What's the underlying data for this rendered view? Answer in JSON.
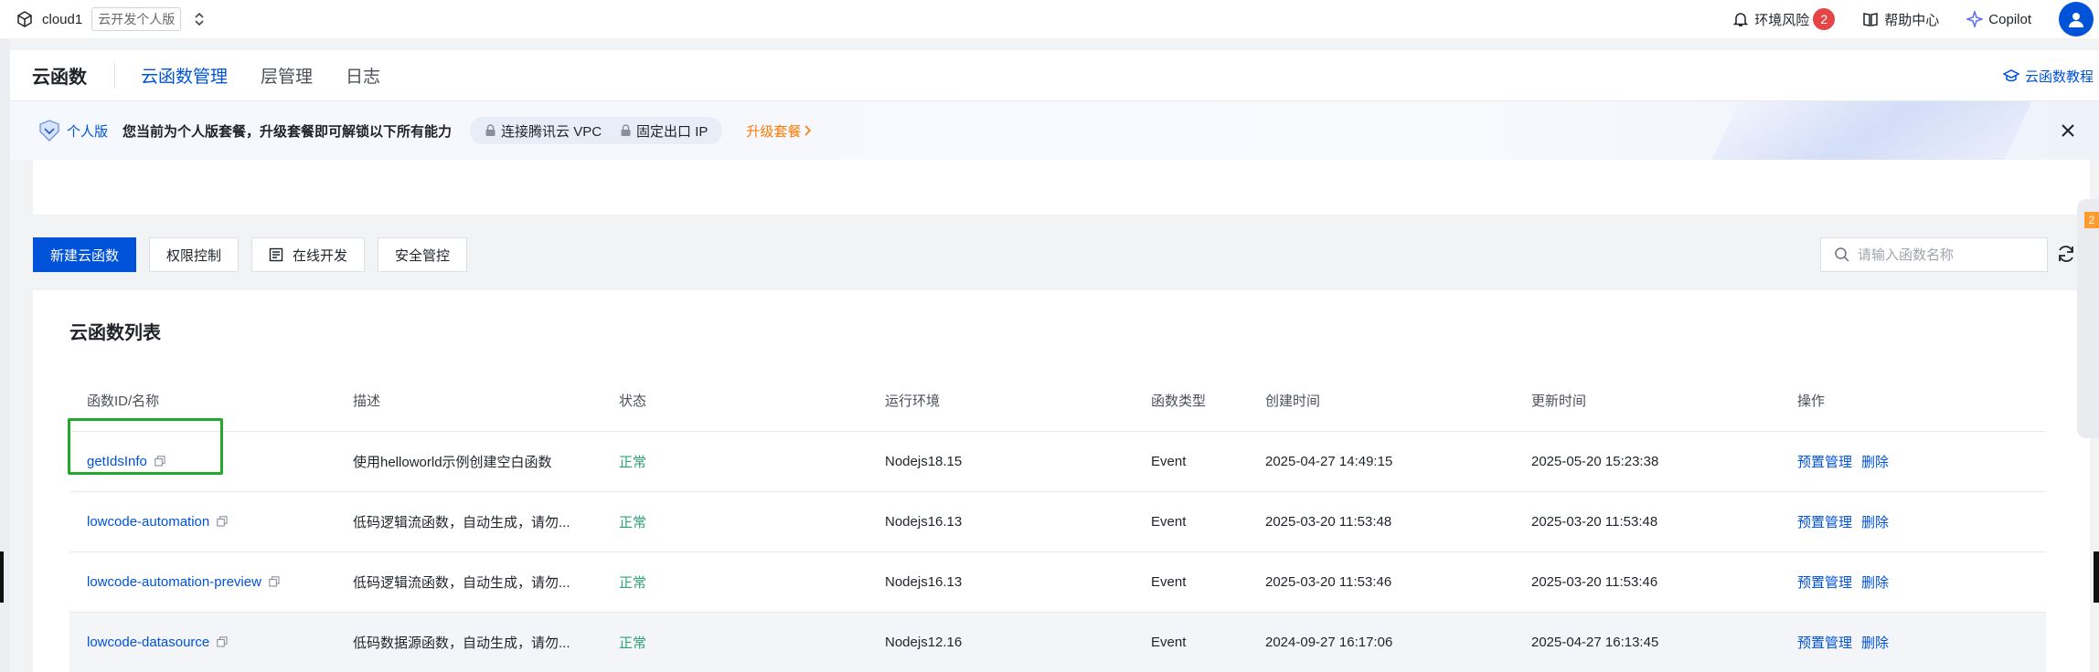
{
  "topbar": {
    "env_name": "cloud1",
    "plan_tag": "云开发个人版",
    "switch_glyph": "⌃⌄",
    "env_risk_label": "环境风险",
    "env_risk_count": "2",
    "help_label": "帮助中心",
    "copilot_label": "Copilot"
  },
  "header": {
    "title": "云函数",
    "tabs": [
      {
        "label": "云函数管理",
        "active": true
      },
      {
        "label": "层管理",
        "active": false
      },
      {
        "label": "日志",
        "active": false
      }
    ],
    "tutorial_label": "云函数教程"
  },
  "banner": {
    "plan_label": "个人版",
    "desc": "您当前为个人版套餐，升级套餐即可解锁以下所有能力",
    "features": [
      "连接腾讯云 VPC",
      "固定出口 IP"
    ],
    "upgrade_label": "升级套餐"
  },
  "toolbar": {
    "create_label": "新建云函数",
    "perm_label": "权限控制",
    "online_dev_label": "在线开发",
    "security_label": "安全管控",
    "search_placeholder": "请输入函数名称"
  },
  "list": {
    "title": "云函数列表",
    "columns": [
      "函数ID/名称",
      "描述",
      "状态",
      "运行环境",
      "函数类型",
      "创建时间",
      "更新时间",
      "操作"
    ],
    "rows": [
      {
        "name": "getIdsInfo",
        "desc": "使用helloworld示例创建空白函数",
        "status": "正常",
        "runtime": "Nodejs18.15",
        "type": "Event",
        "created": "2025-04-27 14:49:15",
        "updated": "2025-05-20 15:23:38",
        "op1": "预置管理",
        "op2": "删除"
      },
      {
        "name": "lowcode-automation",
        "desc": "低码逻辑流函数，自动生成，请勿...",
        "status": "正常",
        "runtime": "Nodejs16.13",
        "type": "Event",
        "created": "2025-03-20 11:53:48",
        "updated": "2025-03-20 11:53:48",
        "op1": "预置管理",
        "op2": "删除"
      },
      {
        "name": "lowcode-automation-preview",
        "desc": "低码逻辑流函数，自动生成，请勿...",
        "status": "正常",
        "runtime": "Nodejs16.13",
        "type": "Event",
        "created": "2025-03-20 11:53:46",
        "updated": "2025-03-20 11:53:46",
        "op1": "预置管理",
        "op2": "删除"
      },
      {
        "name": "lowcode-datasource",
        "desc": "低码数据源函数，自动生成，请勿...",
        "status": "正常",
        "runtime": "Nodejs12.16",
        "type": "Event",
        "created": "2024-09-27 16:17:06",
        "updated": "2025-04-27 16:13:45",
        "op1": "预置管理",
        "op2": "删除"
      }
    ]
  },
  "side_widget": {
    "count": "2"
  },
  "colors": {
    "primary": "#0052d9",
    "success": "#2ba471",
    "warning": "#ff7a00",
    "danger": "#e54545",
    "highlight": "#22a82a"
  }
}
